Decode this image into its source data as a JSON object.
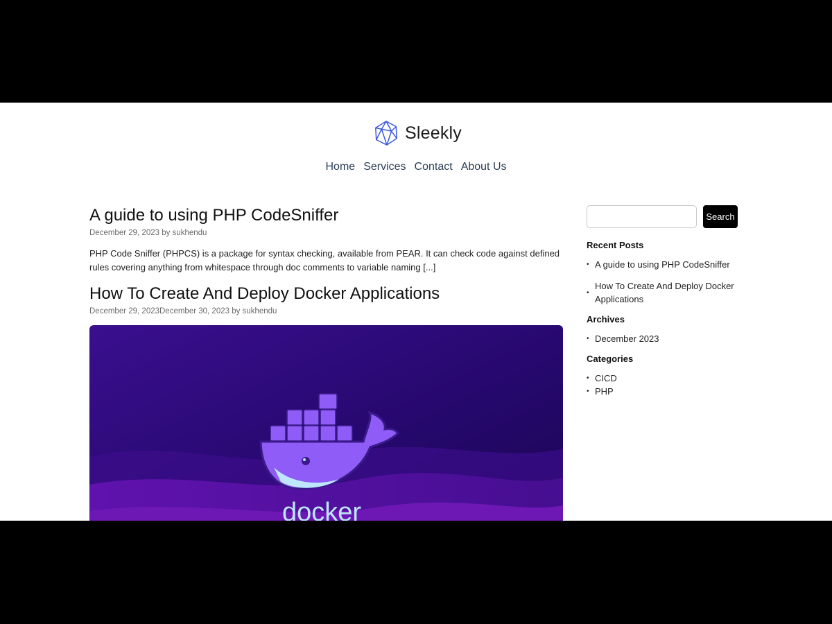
{
  "brand": {
    "name": "Sleekly",
    "logo_icon": "polyhedron-logo-icon",
    "logo_color": "#3b5bdb"
  },
  "nav": {
    "items": [
      "Home",
      "Services",
      "Contact",
      "About Us"
    ]
  },
  "posts": [
    {
      "title": "A guide to using PHP CodeSniffer",
      "meta": "December 29, 2023 by sukhendu",
      "excerpt": "PHP Code Sniffer (PHPCS) is a package for syntax checking, available from PEAR. It can check code against defined rules covering anything from whitespace through doc comments to variable naming [...]"
    },
    {
      "title": "How To Create And Deploy Docker Applications",
      "meta": "December 29, 2023December 30, 2023 by sukhendu",
      "image": {
        "caption": "docker",
        "icon": "docker-whale-icon",
        "bg_color": "#2a0a73",
        "accent_color": "#8f5cf7"
      }
    }
  ],
  "sidebar": {
    "search": {
      "placeholder": "",
      "button_label": "Search"
    },
    "recent_posts": {
      "title": "Recent Posts",
      "items": [
        "A guide to using PHP CodeSniffer",
        "How To Create And Deploy Docker Applications"
      ]
    },
    "archives": {
      "title": "Archives",
      "items": [
        "December 2023"
      ]
    },
    "categories": {
      "title": "Categories",
      "items": [
        "CICD",
        "PHP"
      ]
    }
  }
}
